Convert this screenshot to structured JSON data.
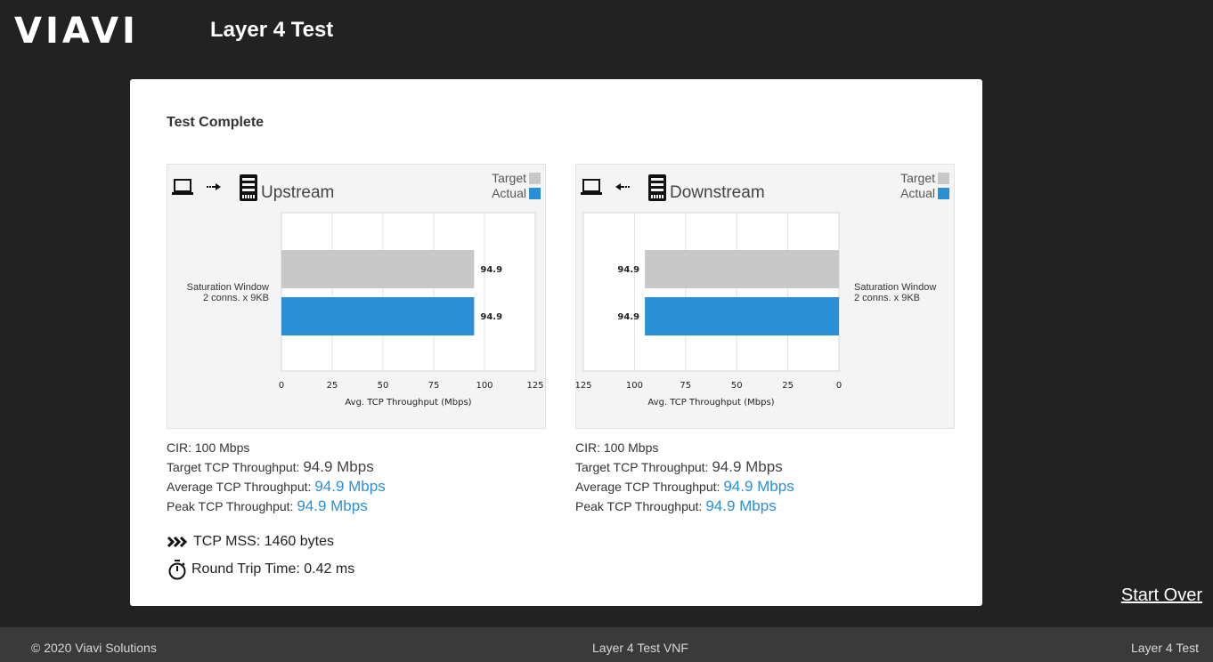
{
  "header": {
    "logo_text": "VIAVI",
    "title": "Layer 4 Test"
  },
  "status": "Test Complete",
  "legend": {
    "target": "Target",
    "actual": "Actual",
    "target_color": "#c8c8c8",
    "actual_color": "#2b8fd6"
  },
  "icons": {
    "client": "laptop-icon",
    "server": "server-icon",
    "arrow_right": "arrow-right-icon",
    "arrow_left": "arrow-left-icon",
    "mss": "chevrons-icon",
    "rtt": "stopwatch-icon"
  },
  "upstream": {
    "title": "Upstream",
    "category_lines": [
      "Saturation Window",
      "2 conns. x 9KB"
    ],
    "cir": "CIR: 100 Mbps",
    "target_label": "Target TCP Throughput:",
    "target_value": "94.9 Mbps",
    "avg_label": "Average TCP Throughput:",
    "avg_value": "94.9 Mbps",
    "peak_label": "Peak TCP Throughput:",
    "peak_value": "94.9 Mbps"
  },
  "downstream": {
    "title": "Downstream",
    "category_lines": [
      "Saturation Window",
      "2 conns. x 9KB"
    ],
    "cir": "CIR: 100 Mbps",
    "target_label": "Target TCP Throughput:",
    "target_value": "94.9 Mbps",
    "avg_label": "Average TCP Throughput:",
    "avg_value": "94.9 Mbps",
    "peak_label": "Peak TCP Throughput:",
    "peak_value": "94.9 Mbps"
  },
  "tcp_mss": "TCP MSS: 1460 bytes",
  "rtt": "Round Trip Time: 0.42 ms",
  "start_over": "Start Over",
  "footer": {
    "copyright": "© 2020 Viavi Solutions",
    "center": "Layer 4 Test VNF",
    "right": "Layer 4 Test"
  },
  "chart_data": [
    {
      "type": "bar",
      "orientation": "horizontal",
      "title": "Upstream",
      "categories": [
        "Saturation Window 2 conns. x 9KB"
      ],
      "series": [
        {
          "name": "Target",
          "values": [
            94.9
          ],
          "labels": [
            "94.9"
          ]
        },
        {
          "name": "Actual",
          "values": [
            94.9
          ],
          "labels": [
            "94.9"
          ]
        }
      ],
      "xlabel": "Avg. TCP Throughput (Mbps)",
      "xticks": [
        "0",
        "25",
        "50",
        "75",
        "100",
        "125"
      ],
      "xlim": [
        0,
        125
      ],
      "reversed": false,
      "grid": true
    },
    {
      "type": "bar",
      "orientation": "horizontal",
      "title": "Downstream",
      "categories": [
        "Saturation Window 2 conns. x 9KB"
      ],
      "series": [
        {
          "name": "Target",
          "values": [
            94.9
          ],
          "labels": [
            "94.9"
          ]
        },
        {
          "name": "Actual",
          "values": [
            94.9
          ],
          "labels": [
            "94.9"
          ]
        }
      ],
      "xlabel": "Avg. TCP Throughput (Mbps)",
      "xticks": [
        "125",
        "100",
        "75",
        "50",
        "25",
        "0"
      ],
      "xlim": [
        0,
        125
      ],
      "reversed": true,
      "grid": true
    }
  ]
}
